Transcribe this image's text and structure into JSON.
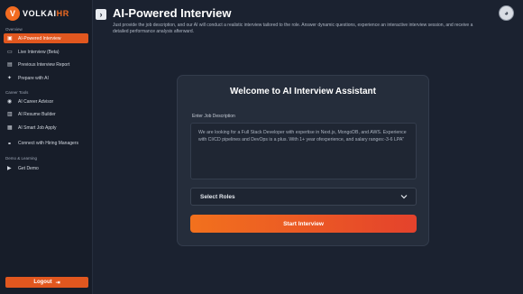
{
  "brand": {
    "logo_text_main": "VOLKAI",
    "logo_text_accent": "HR",
    "logo_mark": "V",
    "accent_color": "#f26b21"
  },
  "collapse_icon": "›",
  "sidebar": {
    "sections": [
      {
        "label": "Overview"
      },
      {
        "label": "Career Tools"
      },
      {
        "label": "Demo & Learning"
      }
    ],
    "items": [
      {
        "label": "AI-Powered Interview",
        "icon": "robot-icon",
        "active": true
      },
      {
        "label": "Live Interview (Beta)",
        "icon": "video-icon"
      },
      {
        "label": "Previous Interview Report",
        "icon": "report-icon"
      },
      {
        "label": "Prepare with AI",
        "icon": "spark-icon"
      },
      {
        "label": "AI Career Advisor",
        "icon": "advisor-icon"
      },
      {
        "label": "AI Resume Builder",
        "icon": "resume-icon"
      },
      {
        "label": "AI Smart Job Apply",
        "icon": "job-icon"
      },
      {
        "label": "Connect with Hiring Managers",
        "icon": "connect-icon"
      },
      {
        "label": "Get Demo",
        "icon": "demo-icon"
      }
    ],
    "logout_label": "Logout"
  },
  "header": {
    "title": "AI-Powered Interview",
    "description": "Just provide the job description, and our AI will conduct a realistic interview tailored to the role. Answer dynamic questions, experience an interactive interview session, and receive a detailed performance analysis afterward."
  },
  "card": {
    "title": "Welcome to AI Interview Assistant",
    "jd_label": "Enter Job Description",
    "jd_value": "We are looking for a Full Stack Developer with expertise in Next.js, MongoDB, and AWS. Experience with CI/CD pipelines and DevOps is a plus. With 1+ year ofexperience, and salary ranges:-3-6 LPA\"",
    "select_value": "Select Roles",
    "start_label": "Start Interview"
  }
}
